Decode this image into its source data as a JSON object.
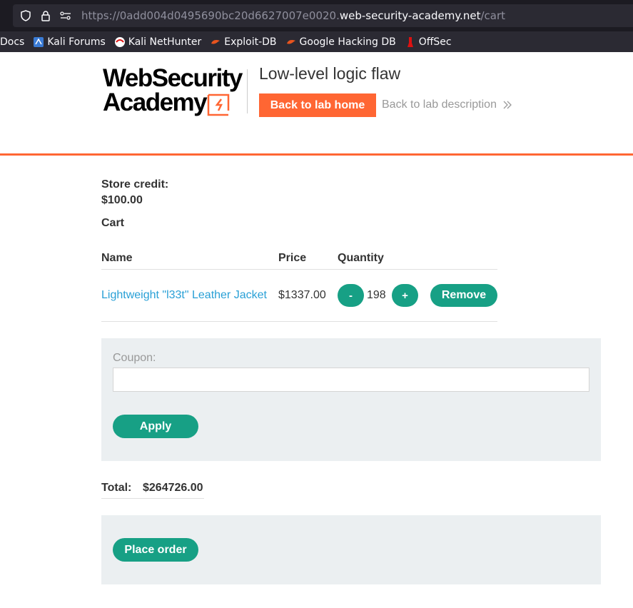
{
  "browser": {
    "url_prefix": "https://0add004d0495690bc20d6627007e0020.",
    "url_host": "web-security-academy.net",
    "url_path": "/cart",
    "bookmarks": [
      {
        "label": "Docs",
        "icon": "docs-icon"
      },
      {
        "label": "Kali Forums",
        "icon": "kali-forums-icon"
      },
      {
        "label": "Kali NetHunter",
        "icon": "kali-nethunter-icon"
      },
      {
        "label": "Exploit-DB",
        "icon": "exploit-db-icon"
      },
      {
        "label": "Google Hacking DB",
        "icon": "google-hacking-db-icon"
      },
      {
        "label": "OffSec",
        "icon": "offsec-icon"
      }
    ]
  },
  "header": {
    "logo_line1": "WebSecurity",
    "logo_line2": "Academy",
    "lab_title": "Low-level logic flaw",
    "back_home_label": "Back to lab home",
    "back_desc_label": "Back to lab description",
    "accent_color": "#ff6633"
  },
  "store": {
    "credit_label": "Store credit:",
    "credit_value": "$100.00",
    "cart_label": "Cart"
  },
  "cart": {
    "columns": [
      "Name",
      "Price",
      "Quantity"
    ],
    "items": [
      {
        "name": "Lightweight \"l33t\" Leather Jacket",
        "price": "$1337.00",
        "quantity": "198",
        "decrement_label": "-",
        "increment_label": "+",
        "remove_label": "Remove"
      }
    ]
  },
  "coupon": {
    "label": "Coupon:",
    "value": "",
    "apply_label": "Apply"
  },
  "total": {
    "label": "Total:",
    "value": "$264726.00"
  },
  "order": {
    "place_order_label": "Place order",
    "button_color": "#17a085"
  }
}
